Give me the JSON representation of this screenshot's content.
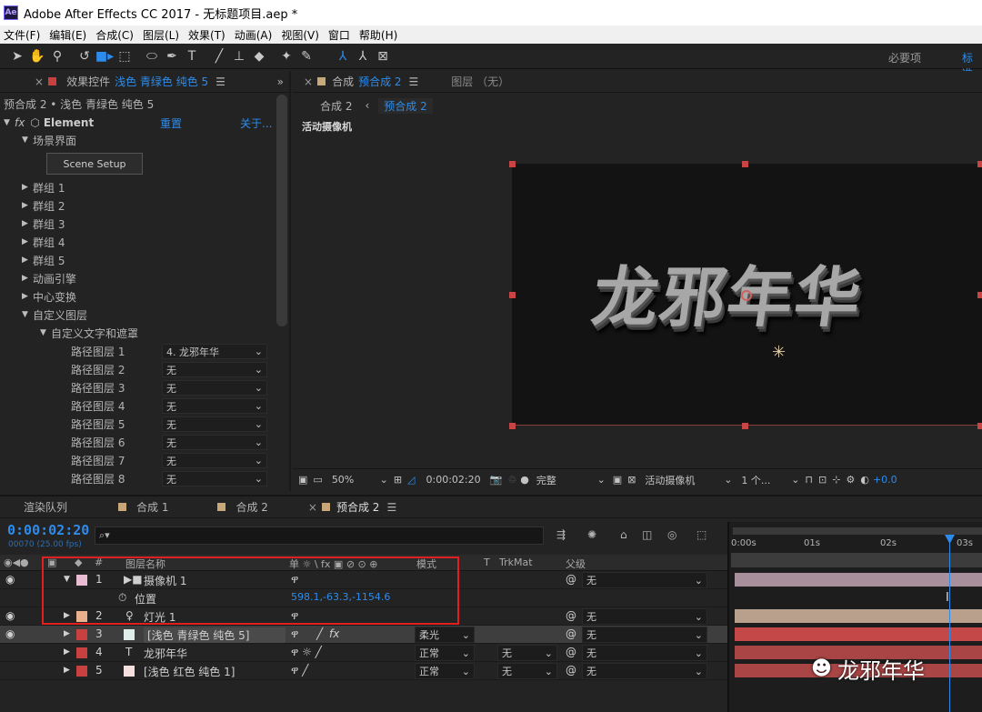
{
  "titlebar": {
    "icon_text": "Ae",
    "title": "Adobe After Effects CC 2017 - 无标题项目.aep *"
  },
  "menu": [
    "文件(F)",
    "编辑(E)",
    "合成(C)",
    "图层(L)",
    "效果(T)",
    "动画(A)",
    "视图(V)",
    "窗口",
    "帮助(H)"
  ],
  "workspace": {
    "essentials": "必要项",
    "standard": "标准"
  },
  "effects_panel": {
    "tab_prefix": "效果控件",
    "tab_layer": "浅色 青绿色 纯色 5",
    "subtitle": "预合成 2 • 浅色 青绿色 纯色 5",
    "fx_label": "fx",
    "effect_name": "Element",
    "reset": "重置",
    "about": "关于...",
    "scene_group": "场景界面",
    "scene_setup": "Scene Setup",
    "groups": [
      "群组 1",
      "群组 2",
      "群组 3",
      "群组 4",
      "群组 5",
      "动画引擎",
      "中心变换"
    ],
    "custom_layer": "自定义图层",
    "custom_text": "自定义文字和遮罩",
    "path_layers": [
      {
        "label": "路径图层 1",
        "value": "4. 龙邪年华"
      },
      {
        "label": "路径图层 2",
        "value": "无"
      },
      {
        "label": "路径图层 3",
        "value": "无"
      },
      {
        "label": "路径图层 4",
        "value": "无"
      },
      {
        "label": "路径图层 5",
        "value": "无"
      },
      {
        "label": "路径图层 6",
        "value": "无"
      },
      {
        "label": "路径图层 7",
        "value": "无"
      },
      {
        "label": "路径图层 8",
        "value": "无"
      }
    ]
  },
  "comp_panel": {
    "tab_prefix": "合成",
    "tab_name": "预合成 2",
    "layer_tab": "图层 （无）",
    "breadcrumb_1": "合成 2",
    "breadcrumb_2": "预合成 2",
    "camera_label": "活动摄像机",
    "comp_text": "龙邪年华",
    "zoom": "50%",
    "timecode": "0:00:02:20",
    "quality": "完整",
    "view": "活动摄像机",
    "views_count": "1 个...",
    "exposure": "+0.0"
  },
  "timeline": {
    "tabs": [
      "渲染队列",
      "合成 1",
      "合成 2",
      "预合成 2"
    ],
    "time": "0:00:02:20",
    "fps": "00070 (25.00 fps)",
    "search_icon": "⌕▾",
    "columns": {
      "num": "#",
      "name": "图层名称",
      "switches": "单 ☼ \\ fx ▣ ⊘ ⊙ ⊕",
      "mode": "模式",
      "t": "T",
      "trkmat": "TrkMat",
      "parent": "父级"
    },
    "ruler": [
      "0:00s",
      "01s",
      "02s",
      "03s"
    ],
    "layers": [
      {
        "num": "1",
        "name": "摄像机 1",
        "icon": "▶■",
        "color": "#e8bcd2",
        "mode": "",
        "trk": "",
        "parent": "无"
      },
      {
        "num": "",
        "name": "位置",
        "value": "598.1,-63.3,-1154.6"
      },
      {
        "num": "2",
        "name": "灯光 1",
        "icon": "💡",
        "color": "#e8b08c",
        "mode": "",
        "trk": "",
        "parent": "无"
      },
      {
        "num": "3",
        "name": "[浅色 青绿色 纯色 5]",
        "icon": "",
        "color": "#c84040",
        "mode": "柔光",
        "trk": "",
        "parent": "无"
      },
      {
        "num": "4",
        "name": "龙邪年华",
        "icon": "T",
        "color": "#c84040",
        "mode": "正常",
        "trk": "无",
        "parent": "无"
      },
      {
        "num": "5",
        "name": "[浅色 红色 纯色 1]",
        "icon": "",
        "color": "#c84040",
        "mode": "正常",
        "trk": "无",
        "parent": "无"
      }
    ]
  },
  "watermark": {
    "text": "龙邪年华"
  }
}
